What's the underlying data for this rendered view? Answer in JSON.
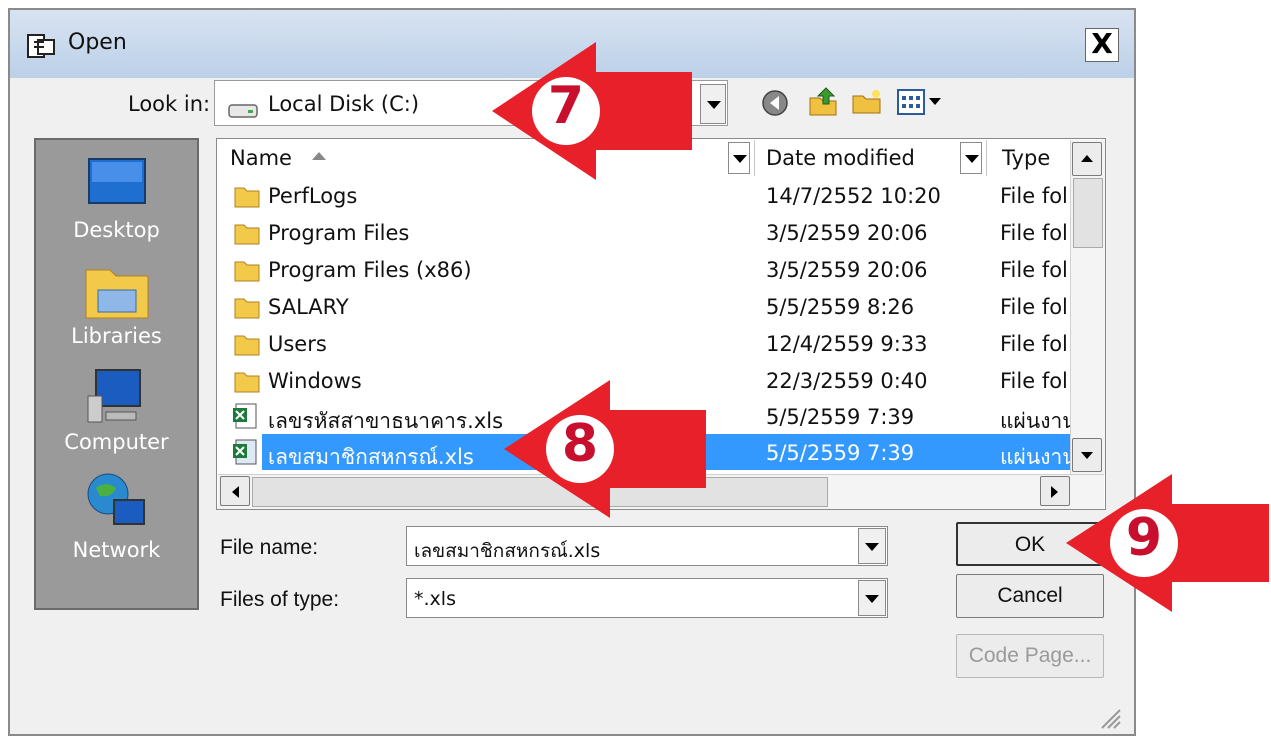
{
  "window": {
    "title": "Open",
    "close_glyph": "X"
  },
  "lookin": {
    "label": "Look in:",
    "value": "Local Disk (C:)"
  },
  "toolbar": {
    "icons": [
      "back-icon",
      "up-folder-icon",
      "new-folder-icon",
      "views-menu-icon"
    ]
  },
  "places": [
    {
      "label": "Desktop",
      "icon": "desktop-icon"
    },
    {
      "label": "Libraries",
      "icon": "libraries-icon"
    },
    {
      "label": "Computer",
      "icon": "computer-icon"
    },
    {
      "label": "Network",
      "icon": "network-icon"
    }
  ],
  "columns": {
    "name": "Name",
    "date": "Date modified",
    "type": "Type"
  },
  "files": [
    {
      "name": "PerfLogs",
      "date": "14/7/2552 10:20",
      "type": "File fol",
      "kind": "folder"
    },
    {
      "name": "Program Files",
      "date": "3/5/2559 20:06",
      "type": "File fol",
      "kind": "folder"
    },
    {
      "name": "Program Files (x86)",
      "date": "3/5/2559 20:06",
      "type": "File fol",
      "kind": "folder"
    },
    {
      "name": "SALARY",
      "date": "5/5/2559 8:26",
      "type": "File fol",
      "kind": "folder"
    },
    {
      "name": "Users",
      "date": "12/4/2559 9:33",
      "type": "File fol",
      "kind": "folder"
    },
    {
      "name": "Windows",
      "date": "22/3/2559 0:40",
      "type": "File fol",
      "kind": "folder"
    },
    {
      "name": "เลขรหัสสาขาธนาคาร.xls",
      "date": "5/5/2559 7:39",
      "type": "แผ่นงาน",
      "kind": "xls"
    },
    {
      "name": "เลขสมาชิกสหกรณ์.xls",
      "date": "5/5/2559 7:39",
      "type": "แผ่นงาน",
      "kind": "xls",
      "selected": true
    }
  ],
  "filename": {
    "label": "File name:",
    "value": "เลขสมาชิกสหกรณ์.xls"
  },
  "filetype": {
    "label": "Files of type:",
    "value": "*.xls"
  },
  "buttons": {
    "ok": "OK",
    "cancel": "Cancel",
    "codepage": "Code Page..."
  },
  "annotations": [
    {
      "number": "7"
    },
    {
      "number": "8"
    },
    {
      "number": "9"
    }
  ],
  "colors": {
    "selection": "#3399ff",
    "annotation_red": "#e8202a"
  }
}
